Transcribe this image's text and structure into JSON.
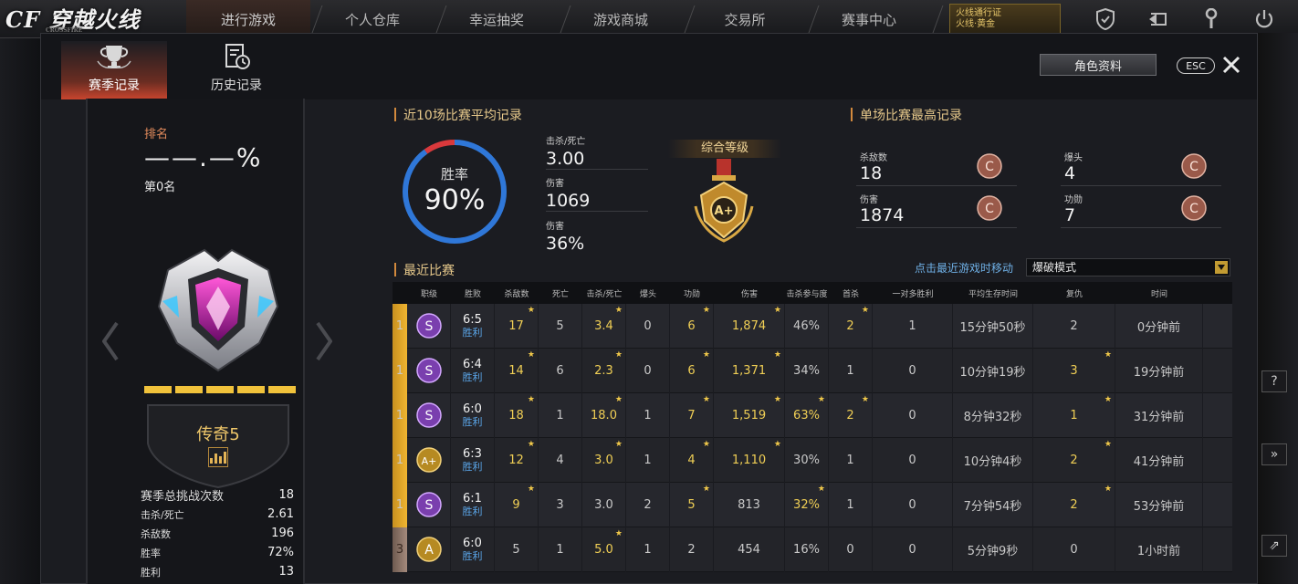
{
  "topbar": {
    "logo_text": "CF 穿越火线",
    "logo_sub": "CROSSFIRE",
    "nav": [
      "进行游戏",
      "个人仓库",
      "幸运抽奖",
      "游戏商城",
      "交易所",
      "赛事中心"
    ],
    "promo_line1": "火线通行证",
    "promo_line2": "火线·黄金",
    "icons": [
      "shield-icon",
      "back-icon",
      "wrench-icon",
      "power-icon"
    ]
  },
  "tabs": [
    {
      "label": "赛季记录",
      "icon": "trophy-icon",
      "active": true
    },
    {
      "label": "历史记录",
      "icon": "history-icon",
      "active": false
    }
  ],
  "header_buttons": {
    "profile": "角色资料",
    "esc": "ESC"
  },
  "rank": {
    "label": "排名",
    "percent": "——.—%",
    "position": "第0名",
    "tier": "传奇5",
    "progress_segments": 5
  },
  "season_stats": [
    {
      "label": "赛季总挑战次数",
      "value": "18"
    },
    {
      "label": "击杀/死亡",
      "value": "2.61"
    },
    {
      "label": "杀敌数",
      "value": "196"
    },
    {
      "label": "胜率",
      "value": "72%"
    },
    {
      "label": "胜利",
      "value": "13"
    }
  ],
  "avg": {
    "title": "近10场比赛平均记录",
    "winrate_label": "胜率",
    "winrate_value": "90%",
    "winrate_fraction": 0.9,
    "stats": [
      {
        "label": "击杀/死亡",
        "value": "3.00"
      },
      {
        "label": "伤害",
        "value": "1069"
      },
      {
        "label": "伤害",
        "value": "36%"
      }
    ],
    "grade_label": "综合等级",
    "grade": "A+"
  },
  "best": {
    "title": "单场比赛最高记录",
    "items": [
      {
        "label": "杀敌数",
        "value": "18",
        "badge": "C"
      },
      {
        "label": "爆头",
        "value": "4",
        "badge": "C"
      },
      {
        "label": "伤害",
        "value": "1874",
        "badge": "C"
      },
      {
        "label": "功勋",
        "value": "7",
        "badge": "C"
      }
    ]
  },
  "recent": {
    "title": "最近比赛",
    "hint": "点击最近游戏时移动",
    "mode": "爆破模式",
    "columns": [
      "职级",
      "胜败",
      "杀敌数",
      "死亡",
      "击杀/死亡",
      "爆头",
      "功勋",
      "伤害",
      "击杀参与度",
      "首杀",
      "一对多胜利",
      "平均生存时间",
      "复仇",
      "时间"
    ],
    "rows": [
      {
        "rank": "1",
        "rank_style": "gold",
        "grade": "S",
        "score": "6:5",
        "result": "胜利",
        "kills": "17",
        "deaths": "5",
        "kd": "3.4",
        "hs": "0",
        "merit": "6",
        "damage": "1,874",
        "part": "46%",
        "first": "2",
        "clutch": "1",
        "survive": "15分钟50秒",
        "revenge": "2",
        "time": "0分钟前",
        "stars": [
          1,
          0,
          1,
          0,
          1,
          1,
          0,
          1,
          0,
          0,
          0,
          0
        ]
      },
      {
        "rank": "1",
        "rank_style": "gold",
        "grade": "S",
        "score": "6:4",
        "result": "胜利",
        "kills": "14",
        "deaths": "6",
        "kd": "2.3",
        "hs": "0",
        "merit": "6",
        "damage": "1,371",
        "part": "34%",
        "first": "1",
        "clutch": "0",
        "survive": "10分钟19秒",
        "revenge": "3",
        "time": "19分钟前",
        "stars": [
          1,
          0,
          1,
          0,
          1,
          1,
          0,
          0,
          0,
          0,
          1,
          0
        ]
      },
      {
        "rank": "1",
        "rank_style": "gold",
        "grade": "S",
        "score": "6:0",
        "result": "胜利",
        "kills": "18",
        "deaths": "1",
        "kd": "18.0",
        "hs": "1",
        "merit": "7",
        "damage": "1,519",
        "part": "63%",
        "first": "2",
        "clutch": "0",
        "survive": "8分钟32秒",
        "revenge": "1",
        "time": "31分钟前",
        "stars": [
          1,
          0,
          1,
          0,
          1,
          1,
          1,
          1,
          0,
          0,
          1,
          0
        ]
      },
      {
        "rank": "1",
        "rank_style": "gold",
        "grade": "A+",
        "score": "6:3",
        "result": "胜利",
        "kills": "12",
        "deaths": "4",
        "kd": "3.0",
        "hs": "1",
        "merit": "4",
        "damage": "1,110",
        "part": "30%",
        "first": "1",
        "clutch": "0",
        "survive": "10分钟4秒",
        "revenge": "2",
        "time": "41分钟前",
        "stars": [
          1,
          0,
          1,
          0,
          1,
          1,
          0,
          0,
          0,
          0,
          1,
          0
        ]
      },
      {
        "rank": "1",
        "rank_style": "gold",
        "grade": "S",
        "score": "6:1",
        "result": "胜利",
        "kills": "9",
        "deaths": "3",
        "kd": "3.0",
        "hs": "2",
        "merit": "5",
        "damage": "813",
        "part": "32%",
        "first": "1",
        "clutch": "0",
        "survive": "7分钟54秒",
        "revenge": "2",
        "time": "53分钟前",
        "stars": [
          1,
          0,
          0,
          0,
          1,
          0,
          1,
          0,
          0,
          0,
          1,
          0
        ]
      },
      {
        "rank": "3",
        "rank_style": "gray",
        "grade": "A",
        "score": "6:0",
        "result": "胜利",
        "kills": "5",
        "deaths": "1",
        "kd": "5.0",
        "hs": "1",
        "merit": "2",
        "damage": "454",
        "part": "16%",
        "first": "0",
        "clutch": "0",
        "survive": "5分钟9秒",
        "revenge": "0",
        "time": "1小时前",
        "stars": [
          0,
          0,
          1,
          0,
          0,
          0,
          0,
          0,
          0,
          0,
          0,
          0
        ]
      }
    ]
  },
  "colors": {
    "accent_gold": "#f0c23b",
    "win_blue": "#5aa5e8",
    "title_gold": "#e7c98b",
    "ring_blue": "#2f77d8",
    "ring_red": "#d9393c"
  }
}
